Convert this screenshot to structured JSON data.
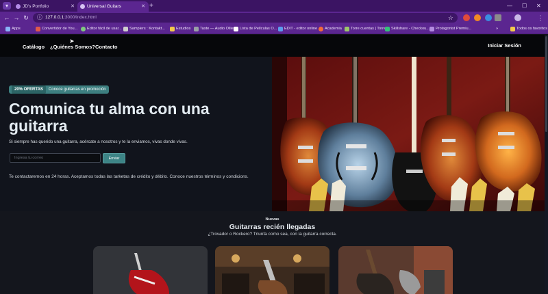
{
  "browser": {
    "tabs": [
      {
        "title": "JD's Portfolio",
        "active": false
      },
      {
        "title": "Universal Guitars",
        "active": true
      }
    ],
    "url_host": "127.0.0.1",
    "url_path": ":3000/index.html",
    "bookmarks": [
      {
        "label": "Apps",
        "color": "#8ab4f8"
      },
      {
        "label": "Convertidor de You...",
        "color": "#e05a4a"
      },
      {
        "label": "Editor fácil de usar...",
        "color": "#7fc97f"
      },
      {
        "label": "Samplers : Kontakt...",
        "color": "#cfcfcf"
      },
      {
        "label": "Estudios",
        "color": "#f2c94c"
      },
      {
        "label": "Taste — Audio Ollie",
        "color": "#9aa0a6"
      },
      {
        "label": "Lista de Películas O...",
        "color": "#ffffff"
      },
      {
        "label": "EDIT - editor online",
        "color": "#5c9ded"
      },
      {
        "label": "Academia",
        "color": "#f26b3a"
      },
      {
        "label": "Torre cuentas | Torre",
        "color": "#9cc76b"
      },
      {
        "label": "Skillshare - Checkou...",
        "color": "#35c17a"
      },
      {
        "label": "Protagonist Premiu...",
        "color": "#b38be0"
      },
      {
        "label": "Todos os favoritos",
        "color": "#f2c94c"
      }
    ],
    "bookmarks_more": "»"
  },
  "site": {
    "nav": [
      "Catálogo",
      "¿Quiénes Somos?",
      "Contacto"
    ],
    "login": "Iniciar Sesión"
  },
  "hero": {
    "badge_pill": "20% OFERTAS",
    "badge_text": "Conoce guitarras en promoción",
    "title": "Comunica tu alma con una guitarra",
    "subtitle": "Si siempre has querido una guitarra, acércate a nosotros y te la enviamos, vivas donde vivas.",
    "email_placeholder": "Ingresa tu correo",
    "send_label": "Enviar",
    "note": "Te contactaremos en 24 horas. Aceptamos todas las tarketas de crédito y débito. Conoce nuestros términos y condicions."
  },
  "arrivals": {
    "eyebrow": "Nuevas",
    "title": "Guitarras recién llegadas",
    "subtitle": "¿Trovador o Rockero? Triunfa como sea, con la guitarra correcta."
  },
  "colors": {
    "browser_frame": "#5b2690",
    "tab_strip": "#3b1463",
    "accent_teal": "#3d8486",
    "page_bg": "#11141c"
  }
}
